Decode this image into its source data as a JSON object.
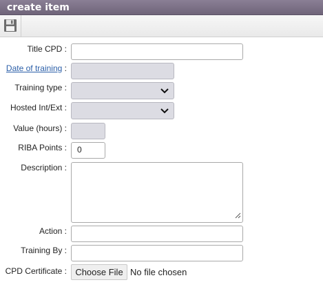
{
  "window": {
    "title": "create item"
  },
  "toolbar": {
    "save_icon": "floppy-disk-icon"
  },
  "form": {
    "title_cpd": {
      "label": "Title CPD :",
      "value": ""
    },
    "date_of_training": {
      "label": "Date of training",
      "suffix": ":",
      "value": ""
    },
    "training_type": {
      "label": "Training type :",
      "value": ""
    },
    "hosted": {
      "label": "Hosted Int/Ext :",
      "value": ""
    },
    "value_hours": {
      "label": "Value (hours) :",
      "value": ""
    },
    "riba_points": {
      "label": "RIBA Points :",
      "value": "0"
    },
    "description": {
      "label": "Description :",
      "value": ""
    },
    "action": {
      "label": "Action :",
      "value": ""
    },
    "training_by": {
      "label": "Training By :",
      "value": ""
    },
    "cpd_certificate": {
      "label": "CPD Certificate :",
      "button": "Choose File",
      "status": "No file chosen"
    }
  },
  "colors": {
    "titlebar": "#7a6f85",
    "link": "#2a5ea8",
    "disabled_field": "#dcdce3"
  }
}
